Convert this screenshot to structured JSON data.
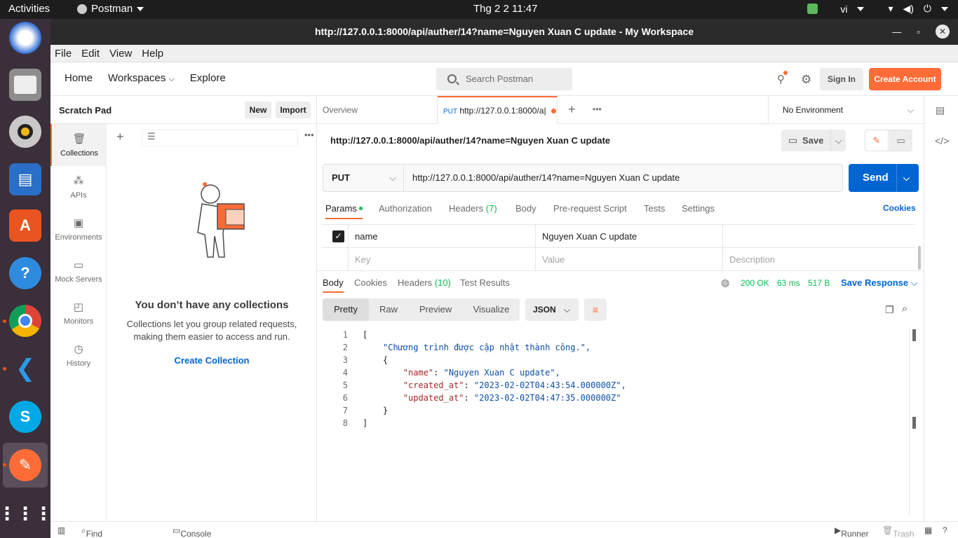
{
  "system": {
    "activities": "Activities",
    "app_name": "Postman",
    "clock": "Thg 2 2  11:47",
    "lang": "vi"
  },
  "window": {
    "title": "http://127.0.0.1:8000/api/auther/14?name=Nguyen Xuan C update - My Workspace"
  },
  "menu": [
    "File",
    "Edit",
    "View",
    "Help"
  ],
  "header": {
    "nav": [
      "Home",
      "Workspaces",
      "Explore"
    ],
    "search_placeholder": "Search Postman",
    "sign_in": "Sign In",
    "create_account": "Create Account"
  },
  "sidebar": {
    "title": "Scratch Pad",
    "new_label": "New",
    "import_label": "Import",
    "rail": [
      "Collections",
      "APIs",
      "Environments",
      "Mock Servers",
      "Monitors",
      "History"
    ],
    "empty_title": "You don’t have any collections",
    "empty_line1": "Collections let you group related requests,",
    "empty_line2": "making them easier to access and run.",
    "create_collection": "Create Collection"
  },
  "tabs": {
    "overview": "Overview",
    "active_method": "PUT",
    "active_url": "http://127.0.0.1:8000/a|",
    "environment": "No Environment"
  },
  "request": {
    "title": "http://127.0.0.1:8000/api/auther/14?name=Nguyen Xuan C update",
    "save": "Save",
    "method": "PUT",
    "url": "http://127.0.0.1:8000/api/auther/14?name=Nguyen Xuan C update",
    "send": "Send",
    "tabs": {
      "params": "Params",
      "authorization": "Authorization",
      "headers": "Headers",
      "headers_count": "(7)",
      "body": "Body",
      "prerequest": "Pre-request Script",
      "tests": "Tests",
      "settings": "Settings",
      "cookies": "Cookies"
    },
    "params": {
      "row_key": "name",
      "row_value": "Nguyen Xuan C update",
      "key_placeholder": "Key",
      "value_placeholder": "Value",
      "description_placeholder": "Description"
    }
  },
  "response": {
    "tabs": {
      "body": "Body",
      "cookies": "Cookies",
      "headers": "Headers",
      "headers_count": "(10)",
      "test_results": "Test Results"
    },
    "status": "200 OK",
    "time": "63 ms",
    "size": "517 B",
    "save_response": "Save Response",
    "views": [
      "Pretty",
      "Raw",
      "Preview",
      "Visualize"
    ],
    "format": "JSON",
    "lines": [
      {
        "n": "1",
        "text": "["
      },
      {
        "n": "2",
        "text": "    \"Chương trình được cập nhật thành công.\","
      },
      {
        "n": "3",
        "text": "    {"
      },
      {
        "n": "4",
        "key": "\"name\"",
        "value": "\"Nguyen Xuan C update\","
      },
      {
        "n": "5",
        "key": "\"created_at\"",
        "value": "\"2023-02-02T04:43:54.000000Z\","
      },
      {
        "n": "6",
        "key": "\"updated_at\"",
        "value": "\"2023-02-02T04:47:35.000000Z\""
      },
      {
        "n": "7",
        "text": "    }"
      },
      {
        "n": "8",
        "text": "]"
      }
    ]
  },
  "statusbar": {
    "find_replace": "Find and Replace",
    "console": "Console",
    "runner": "Runner",
    "trash": "Trash"
  },
  "colors": {
    "accent": "#ff6c37",
    "primary": "#0265d2",
    "success": "#0cbb52"
  }
}
